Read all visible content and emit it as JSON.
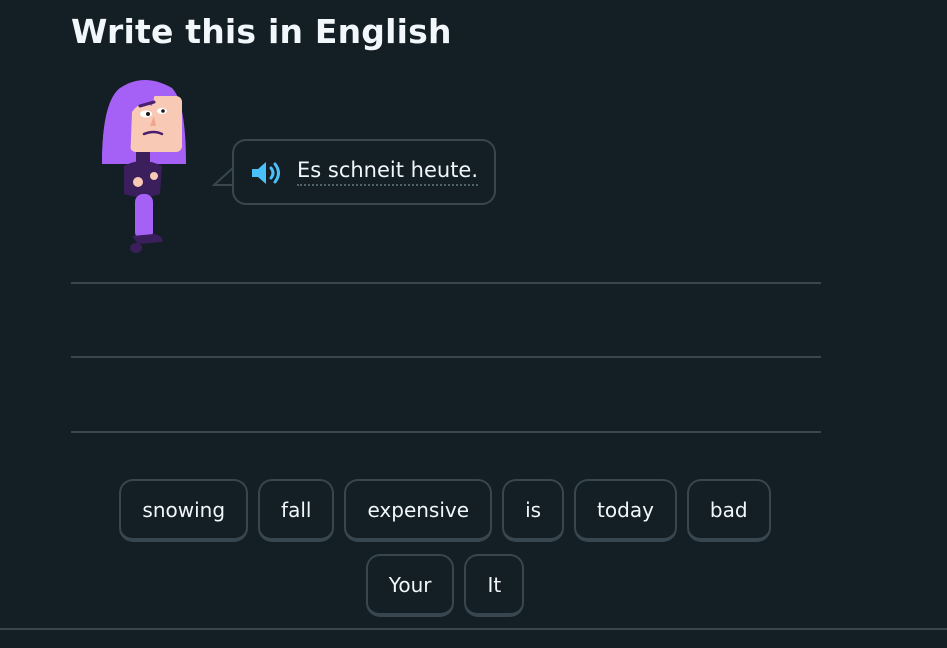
{
  "header": {
    "title": "Write this in English"
  },
  "character": {
    "icon": "character-illustration",
    "hair_color": "#a560f5",
    "body_color": "#9b5cf6"
  },
  "prompt": {
    "audio_icon": "speaker-icon",
    "text": "Es schneit heute."
  },
  "answer_area": {
    "line_count": 3
  },
  "word_bank": {
    "row1": [
      "snowing",
      "fall",
      "expensive",
      "is",
      "today",
      "bad"
    ],
    "row2": [
      "Your",
      "It"
    ]
  },
  "colors": {
    "background": "#131f24",
    "border": "#37464f",
    "text": "#f1f7fb",
    "speaker": "#49c0f8"
  }
}
